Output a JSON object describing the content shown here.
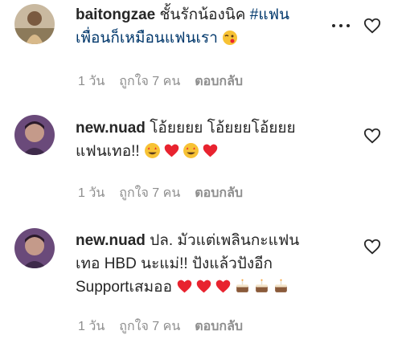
{
  "comments": [
    {
      "username": "baitongzae",
      "text_line1": " ชั้นรักน้องนิค ",
      "hashtag_part1": "#แฟน",
      "hashtag_part2": "เพื่อนก็เหมือนแฟนเรา",
      "emojis_end": [
        "winking-face-kiss"
      ],
      "meta": {
        "time": "1 วัน",
        "likes": "ถูกใจ 7 คน",
        "reply": "ตอบกลับ"
      },
      "avatar_icon": "avatar-photo"
    },
    {
      "username": "new.nuad",
      "text_line1": " โอ้ยยยย โอ้ยยยโอ้ยยย",
      "text_line2": "แฟนเทอ!! ",
      "emojis_end": [
        "star-struck",
        "red-heart",
        "star-struck",
        "red-heart"
      ],
      "meta": {
        "time": "1 วัน",
        "likes": "ถูกใจ 7 คน",
        "reply": "ตอบกลับ"
      },
      "avatar_icon": "avatar-photo"
    },
    {
      "username": "new.nuad",
      "text_line1": " ปล. มัวแต่เพลินกะแฟน",
      "text_line2": "เทอ HBD นะแม่!! ปังแล้วปังอีก",
      "text_line3": "Supportเสมออ ",
      "emojis_end": [
        "red-heart",
        "red-heart",
        "red-heart",
        "cake",
        "cake",
        "cake"
      ],
      "meta": {
        "time": "1 วัน",
        "likes": "ถูกใจ 7 คน",
        "reply": "ตอบกลับ"
      },
      "avatar_icon": "avatar-photo"
    }
  ],
  "colors": {
    "text": "#262626",
    "meta": "#8e8e8e",
    "hashtag": "#00376b",
    "heart": "#e8232f"
  }
}
